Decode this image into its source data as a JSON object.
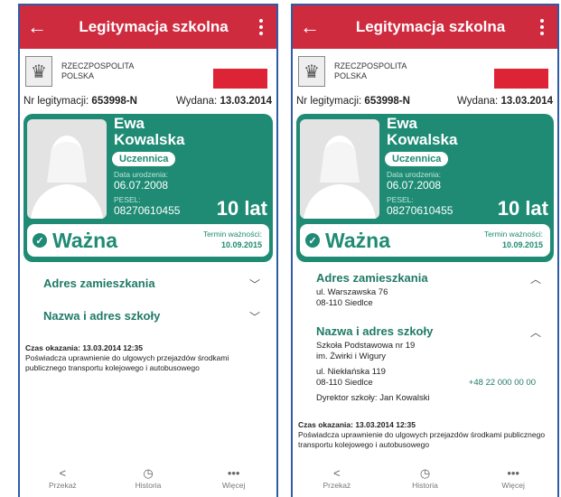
{
  "left": {
    "appbar": {
      "back": "←",
      "title": "Legitymacja szkolna"
    },
    "header": {
      "country": [
        "RZECZPOSPOLITA",
        "POLSKA"
      ]
    },
    "id": {
      "nr_label": "Nr legitymacji:",
      "nr_value": "653998-N",
      "issued_label": "Wydana:",
      "issued_value": "13.03.2014"
    },
    "card": {
      "first_name": "Ewa",
      "last_name": "Kowalska",
      "role": "Uczennica",
      "dob_label": "Data urodzenia:",
      "dob": "06.07.2008",
      "pesel_label": "PESEL:",
      "pesel": "08270610455",
      "age": "10 lat",
      "status": "Ważna",
      "term_label": "Termin ważności:",
      "term": "10.09.2015"
    },
    "sections": {
      "address": "Adres zamieszkania",
      "school": "Nazwa i adres szkoły"
    },
    "scan": {
      "label": "Czas okazania:",
      "value": "13.03.2014 12:35",
      "text": "Poświadcza uprawnienie do ulgowych przejazdów środkami publicznego transportu kolejowego i autobusowego"
    },
    "nav": {
      "share": "Przekaż",
      "history": "Historia",
      "more": "Więcej"
    }
  },
  "right": {
    "appbar": {
      "back": "←",
      "title": "Legitymacja szkolna"
    },
    "header": {
      "country": [
        "RZECZPOSPOLITA",
        "POLSKA"
      ]
    },
    "id": {
      "nr_label": "Nr legitymacji:",
      "nr_value": "653998-N",
      "issued_label": "Wydana:",
      "issued_value": "13.03.2014"
    },
    "card": {
      "first_name": "Ewa",
      "last_name": "Kowalska",
      "role": "Uczennica",
      "dob_label": "Data urodzenia:",
      "dob": "06.07.2008",
      "pesel_label": "PESEL:",
      "pesel": "08270610455",
      "age": "10 lat",
      "status": "Ważna",
      "term_label": "Termin ważności:",
      "term": "10.09.2015"
    },
    "address": {
      "title": "Adres zamieszkania",
      "line1": "ul. Warszawska 76",
      "line2": "08-110 Siedlce"
    },
    "school": {
      "title": "Nazwa i adres szkoły",
      "name1": "Szkoła Podstawowa nr 19",
      "name2": "im. Żwirki i Wigury",
      "street": "ul. Niekłańska 119",
      "city": "08-110 Siedlce",
      "phone": "+48 22 000 00 00",
      "director": "Dyrektor szkoły: Jan Kowalski"
    },
    "scan": {
      "label": "Czas okazania:",
      "value": "13.03.2014 12:35",
      "text": "Poświadcza uprawnienie do ulgowych przejazdów środkami publicznego transportu kolejowego i autobusowego"
    },
    "nav": {
      "share": "Przekaż",
      "history": "Historia",
      "more": "Więcej"
    }
  },
  "colors": {
    "appbar": "#cf2b3f",
    "card": "#1f8b74",
    "flag_red": "#dc2436"
  },
  "icons": {
    "back": "arrow-left-icon",
    "menu": "kebab-menu-icon",
    "share": "share-icon",
    "history": "history-icon",
    "more": "more-icon",
    "valid": "check-circle-icon",
    "expand": "chevron-down-icon",
    "collapse": "chevron-up-icon"
  }
}
